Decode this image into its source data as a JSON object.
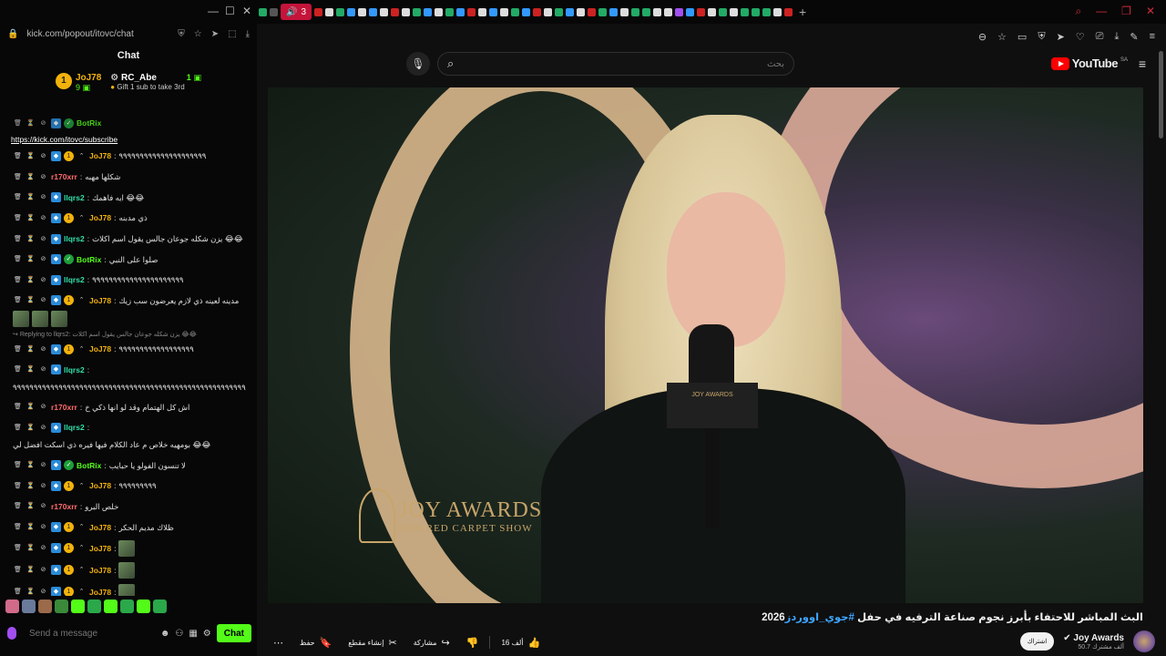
{
  "browser": {
    "active_tab_label": "3",
    "popout_url": "kick.com/popout/itovc/chat"
  },
  "chat": {
    "title": "Chat",
    "leaders": [
      {
        "rank": "1",
        "name": "JoJ78",
        "count": "9"
      },
      {
        "name": "RC_Abe",
        "count": "1",
        "sub_text": "Gift 1 sub to take 3rd"
      }
    ],
    "subscribe_link": "https://kick.com/itovc/subscribe",
    "messages": [
      {
        "user": "JoJ78",
        "color": "gold",
        "text": "٩٩٩٩٩٩٩٩٩٩٩٩٩٩٩٩٩٩٩٩٩"
      },
      {
        "user": "r170xrr",
        "color": "pink",
        "text": "شكلها مهبه"
      },
      {
        "user": "llqrs2",
        "color": "cyan",
        "text": "ايه فاهمك 😂😂"
      },
      {
        "user": "JoJ78",
        "color": "gold",
        "text": "ذي مدبنه"
      },
      {
        "user": "llqrs2",
        "color": "cyan",
        "text": "يزن شكله جوعان جالس يقول اسم اكلات 😂😂"
      },
      {
        "user": "BotRix",
        "color": "green",
        "text": "صلوا على النبي"
      },
      {
        "user": "llqrs2",
        "color": "cyan",
        "text": "٩٩٩٩٩٩٩٩٩٩٩٩٩٩٩٩٩٩٩٩٩٩"
      },
      {
        "user": "JoJ78",
        "color": "gold",
        "text": "مدينه لعينه ذي لازم يعرضون سب زيك"
      },
      {
        "reply_to": "Replying to llqrs2: يزن شكله جوعان جالس يقول اسم اكلات 😂😂"
      },
      {
        "user": "JoJ78",
        "color": "gold",
        "text": "٩٩٩٩٩٩٩٩٩٩٩٩٩٩٩٩٩٩"
      },
      {
        "user": "llqrs2",
        "color": "cyan",
        "text": "٩٩٩٩٩٩٩٩٩٩٩٩٩٩٩٩٩٩٩٩٩٩٩٩٩٩٩٩٩٩٩٩٩٩٩٩٩٩٩٩٩٩٩٩٩٩٩٩٩٩٩٩٩٩٩٩٩٩٩٩٩٩"
      },
      {
        "user": "r170xrr",
        "color": "pink",
        "text": "اش كل الهتمام وقد لو انها ذكي خ"
      },
      {
        "user": "llqrs2",
        "color": "cyan",
        "text": "بومهيه خلاص م عاد الكلام فيها فيره ذي اسكت افضل لي 😂😂"
      },
      {
        "user": "BotRix",
        "color": "green",
        "text": "لا تنسون الفولو يا حبايب"
      },
      {
        "user": "JoJ78",
        "color": "gold",
        "text": "٩٩٩٩٩٩٩٩٩"
      },
      {
        "user": "r170xrr",
        "color": "pink",
        "text": "خلص البرو"
      },
      {
        "user": "JoJ78",
        "color": "gold",
        "text": "ظلاك مديم الحكر"
      },
      {
        "user": "JoJ78",
        "color": "gold",
        "text": ""
      },
      {
        "user": "JoJ78",
        "color": "gold",
        "text": ""
      },
      {
        "user": "JoJ78",
        "color": "gold",
        "text": ""
      }
    ],
    "input_placeholder": "Send a message",
    "send_label": "Chat"
  },
  "youtube": {
    "search_value": "",
    "search_placeholder": "بحث",
    "logo_text": "YouTube",
    "country_code": "SA",
    "video": {
      "overlay_brand": "JOY AWARDS",
      "overlay_sub": "2026 RED CARPET SHOW",
      "mic_flag_text": "JOY AWARDS"
    },
    "title_prefix": "البث المباشر للاحتفاء بأبرز نجوم صناعة الترفيه في حفل ",
    "title_tag": "#جوي_اووردز",
    "title_suffix": "2026",
    "actions": {
      "likes": "16 ألف",
      "share": "مشاركة",
      "clip": "إنشاء مقطع",
      "save": "حفظ"
    },
    "channel": {
      "name": "Joy Awards",
      "subs": "50.7 ألف مشترك",
      "subscribe_label": "اشتراك"
    }
  },
  "colors": {
    "kick_green": "#53fc18",
    "gold": "#f3b20b",
    "yt_red": "#ff0000",
    "hashtag_blue": "#3ea6ff"
  }
}
